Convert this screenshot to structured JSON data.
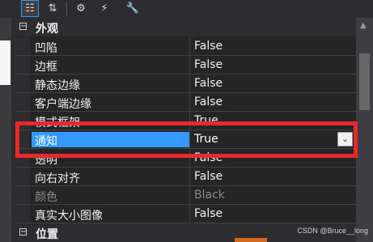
{
  "toolbar": {
    "buttons": [
      {
        "name": "categorized-view-button",
        "icon": "categorized-icon",
        "glyph": "☷",
        "active": true
      },
      {
        "name": "alphabetical-view-button",
        "icon": "alphabetical-icon",
        "glyph": "⇅",
        "active": false
      },
      {
        "name": "properties-button",
        "icon": "properties-icon",
        "glyph": "⚙",
        "active": false
      },
      {
        "name": "events-button",
        "icon": "lightning-icon",
        "glyph": "⚡",
        "active": false
      },
      {
        "name": "property-pages-button",
        "icon": "wrench-icon",
        "glyph": "🔧",
        "active": false
      }
    ]
  },
  "categories": [
    {
      "label": "外观",
      "toggle": "−"
    },
    {
      "label": "位置",
      "toggle": "−"
    }
  ],
  "properties": [
    {
      "name": "凹陷",
      "value": "False"
    },
    {
      "name": "边框",
      "value": "False"
    },
    {
      "name": "静态边缘",
      "value": "False"
    },
    {
      "name": "客户端边缘",
      "value": "False"
    },
    {
      "name": "模式框架",
      "value": "True"
    },
    {
      "name": "通知",
      "value": "True",
      "selected": true
    },
    {
      "name": "透明",
      "value": "False"
    },
    {
      "name": "向右对齐",
      "value": "False"
    },
    {
      "name": "颜色",
      "value": "Black",
      "disabled": true
    },
    {
      "name": "真实大小图像",
      "value": "False"
    }
  ],
  "dropdown_glyph": "⌄",
  "watermark": "CSDN @Bruce__long",
  "colors": {
    "background": "#252526",
    "selection": "#3399ff",
    "annotation": "#e8292b"
  }
}
